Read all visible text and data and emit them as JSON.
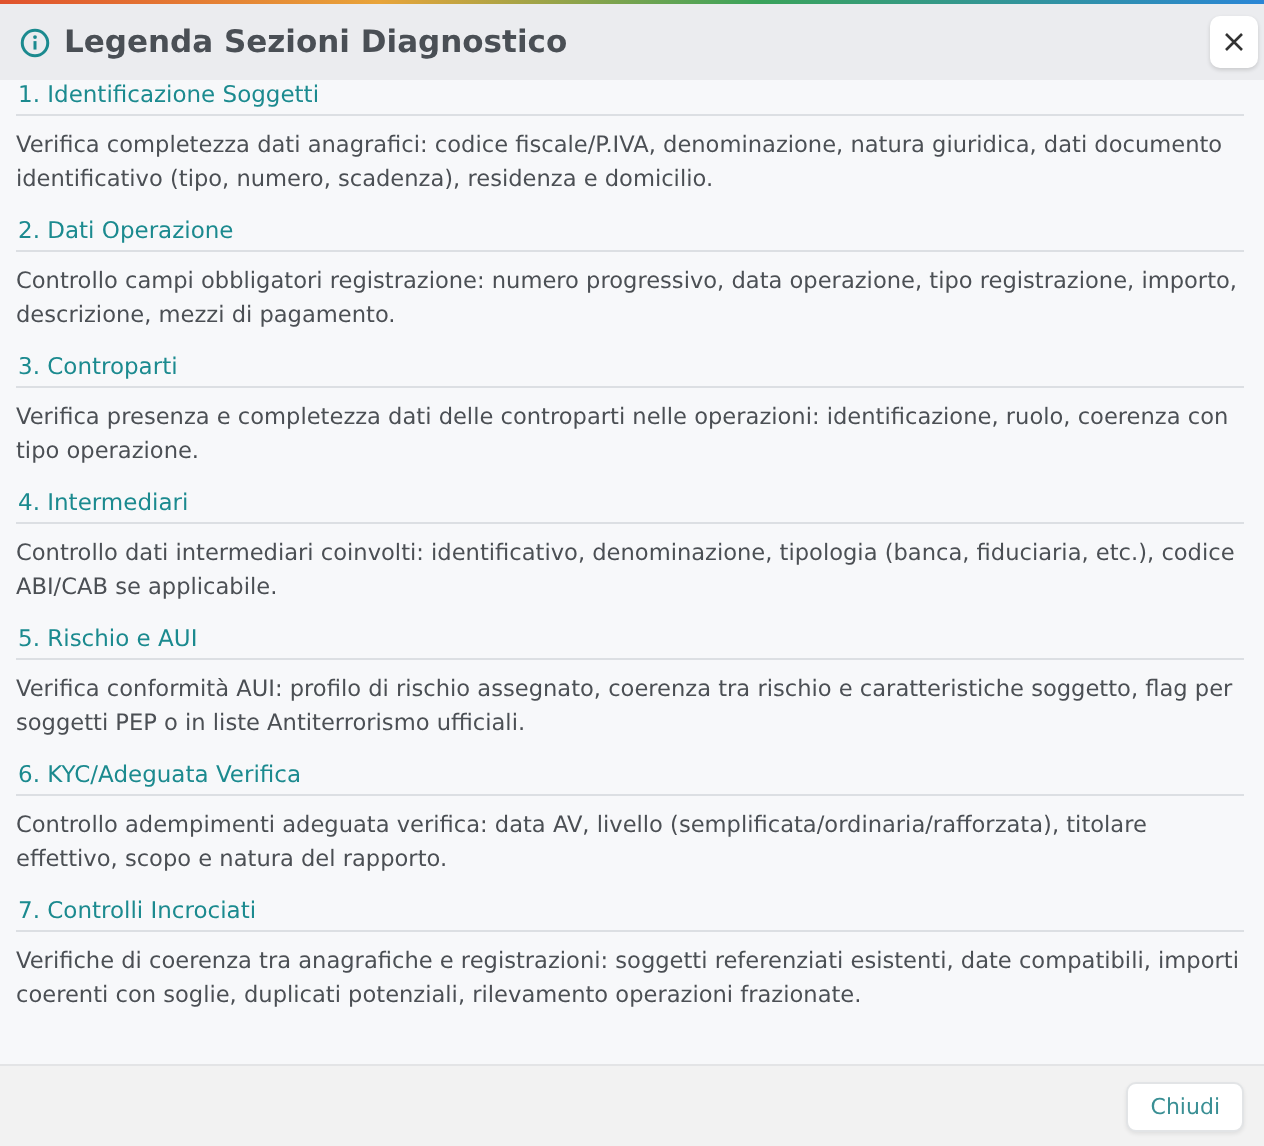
{
  "dialog": {
    "title": "Legenda Sezioni Diagnostico"
  },
  "sections": [
    {
      "heading": "1. Identificazione Soggetti",
      "text": "Verifica completezza dati anagrafici: codice fiscale/P.IVA, denominazione, natura giuridica, dati documento identificativo (tipo, numero, scadenza), residenza e domicilio."
    },
    {
      "heading": "2. Dati Operazione",
      "text": "Controllo campi obbligatori registrazione: numero progressivo, data operazione, tipo registrazione, importo, descrizione, mezzi di pagamento."
    },
    {
      "heading": "3. Controparti",
      "text": "Verifica presenza e completezza dati delle controparti nelle operazioni: identificazione, ruolo, coerenza con tipo operazione."
    },
    {
      "heading": "4. Intermediari",
      "text": "Controllo dati intermediari coinvolti: identificativo, denominazione, tipologia (banca, fiduciaria, etc.), codice ABI/CAB se applicabile."
    },
    {
      "heading": "5. Rischio e AUI",
      "text": "Verifica conformità AUI: profilo di rischio assegnato, coerenza tra rischio e caratteristiche soggetto, flag per soggetti PEP o in liste Antiterrorismo ufficiali."
    },
    {
      "heading": "6. KYC/Adeguata Verifica",
      "text": "Controllo adempimenti adeguata verifica: data AV, livello (semplificata/ordinaria/rafforzata), titolare effettivo, scopo e natura del rapporto."
    },
    {
      "heading": "7. Controlli Incrociati",
      "text": "Verifiche di coerenza tra anagrafiche e registrazioni: soggetti referenziati esistenti, date compatibili, importi coerenti con soglie, duplicati potenziali, rilevamento operazioni frazionate."
    }
  ],
  "footer": {
    "buttons": [
      "Chiudi"
    ]
  }
}
